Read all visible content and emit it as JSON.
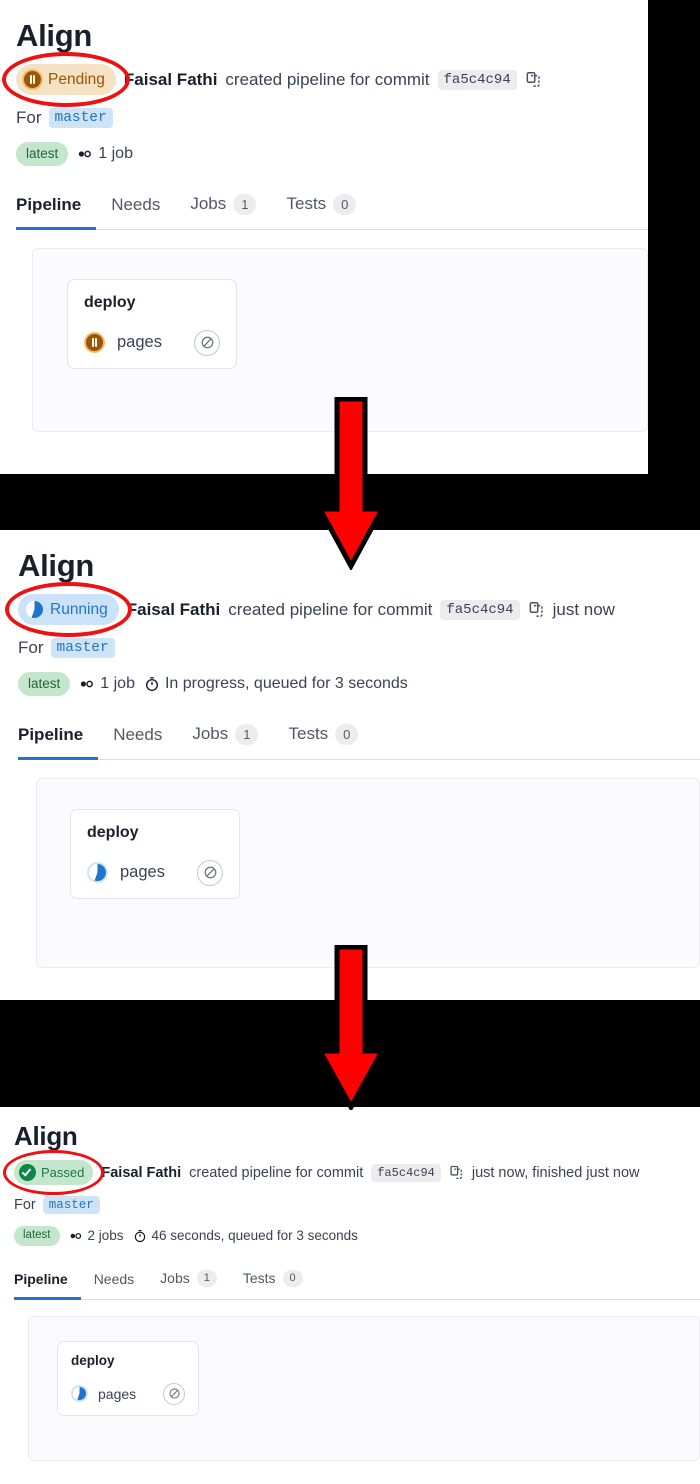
{
  "colors": {
    "pending_bg": "#f5e2c4",
    "pending_fg": "#9e5400",
    "running_bg": "#cbe2f9",
    "running_fg": "#1f75cb",
    "passed_bg": "#c3e6cd",
    "passed_fg": "#217645",
    "latest_bg": "#c3e6cd",
    "ref_bg": "#cfe3f7",
    "accent": "#1f75cb",
    "highlight_ellipse": "#ee1111",
    "arrow": "#ff0000"
  },
  "panels": [
    {
      "title": "Align",
      "status": {
        "label": "Pending",
        "kind": "pending",
        "icon": "pause-circle-icon",
        "highlighted": true
      },
      "author": "Faisal Fathi",
      "commit_text": "created pipeline for commit",
      "sha": "fa5c4c94",
      "copy_icon": "copy-to-clipboard-icon",
      "time_text": "",
      "for_label": "For",
      "ref": "master",
      "latest_label": "latest",
      "jobs_icon": "pipeline-jobs-icon",
      "jobs_text": "1 job",
      "duration_icon": "",
      "duration_text": "",
      "tabs": [
        {
          "label": "Pipeline",
          "count": null,
          "active": true
        },
        {
          "label": "Needs",
          "count": null,
          "active": false
        },
        {
          "label": "Jobs",
          "count": "1",
          "active": false
        },
        {
          "label": "Tests",
          "count": "0",
          "active": false
        }
      ],
      "stage": {
        "name": "deploy",
        "job": {
          "name": "pages",
          "status_kind": "pending",
          "status_icon": "pause-circle-icon",
          "action_icon": "cancel-icon"
        }
      }
    },
    {
      "title": "Align",
      "status": {
        "label": "Running",
        "kind": "running",
        "icon": "running-spinner-icon",
        "highlighted": true
      },
      "author": "Faisal Fathi",
      "commit_text": "created pipeline for commit",
      "sha": "fa5c4c94",
      "copy_icon": "copy-to-clipboard-icon",
      "time_text": "just now",
      "for_label": "For",
      "ref": "master",
      "latest_label": "latest",
      "jobs_icon": "pipeline-jobs-icon",
      "jobs_text": "1 job",
      "duration_icon": "stopwatch-icon",
      "duration_text": "In progress, queued for 3 seconds",
      "tabs": [
        {
          "label": "Pipeline",
          "count": null,
          "active": true
        },
        {
          "label": "Needs",
          "count": null,
          "active": false
        },
        {
          "label": "Jobs",
          "count": "1",
          "active": false
        },
        {
          "label": "Tests",
          "count": "0",
          "active": false
        }
      ],
      "stage": {
        "name": "deploy",
        "job": {
          "name": "pages",
          "status_kind": "running",
          "status_icon": "running-spinner-icon",
          "action_icon": "cancel-icon"
        }
      }
    },
    {
      "title": "Align",
      "status": {
        "label": "Passed",
        "kind": "passed",
        "icon": "check-circle-icon",
        "highlighted": true
      },
      "author": "Faisal Fathi",
      "commit_text": "created pipeline for commit",
      "sha": "fa5c4c94",
      "copy_icon": "copy-to-clipboard-icon",
      "time_text": "just now, finished just now",
      "for_label": "For",
      "ref": "master",
      "latest_label": "latest",
      "jobs_icon": "pipeline-jobs-icon",
      "jobs_text": "2 jobs",
      "duration_icon": "stopwatch-icon",
      "duration_text": "46 seconds, queued for 3 seconds",
      "tabs": [
        {
          "label": "Pipeline",
          "count": null,
          "active": true
        },
        {
          "label": "Needs",
          "count": null,
          "active": false
        },
        {
          "label": "Jobs",
          "count": "1",
          "active": false
        },
        {
          "label": "Tests",
          "count": "0",
          "active": false
        }
      ],
      "stage": {
        "name": "deploy",
        "job": {
          "name": "pages",
          "status_kind": "running",
          "status_icon": "running-spinner-icon",
          "action_icon": "cancel-icon"
        }
      }
    }
  ],
  "arrows": [
    {
      "name": "flow-arrow-1",
      "direction": "down"
    },
    {
      "name": "flow-arrow-2",
      "direction": "down"
    }
  ]
}
